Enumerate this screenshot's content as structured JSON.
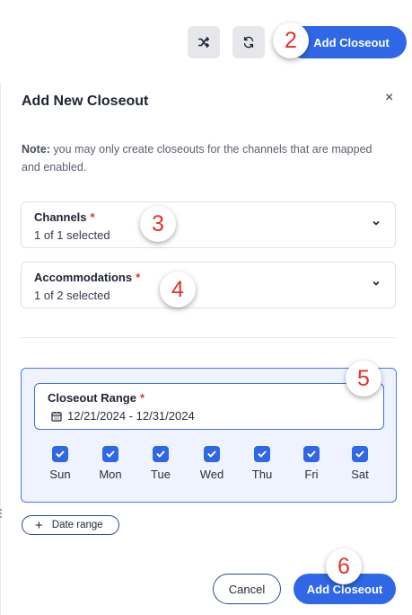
{
  "toolbar": {
    "shuffle_icon": "shuffle-icon",
    "refresh_icon": "refresh-icon",
    "add_closeout_label": "Add Closeout"
  },
  "badges": {
    "b2": "2",
    "b3": "3",
    "b4": "4",
    "b5": "5",
    "b6": "6"
  },
  "panel": {
    "title": "Add New Closeout",
    "close_label": "×",
    "note_prefix": "Note:",
    "note_text": " you may only create closeouts for the channels that are mapped and enabled."
  },
  "channels": {
    "label": "Channels",
    "required_mark": "*",
    "value": "1 of 1 selected"
  },
  "accommodations": {
    "label": "Accommodations",
    "required_mark": "*",
    "value": "1 of 2 selected"
  },
  "closeout_range": {
    "label": "Closeout Range",
    "required_mark": "*",
    "value": "12/21/2024 - 12/31/2024"
  },
  "days": [
    {
      "name": "Sun",
      "checked": true
    },
    {
      "name": "Mon",
      "checked": true
    },
    {
      "name": "Tue",
      "checked": true
    },
    {
      "name": "Wed",
      "checked": true
    },
    {
      "name": "Thu",
      "checked": true
    },
    {
      "name": "Fri",
      "checked": true
    },
    {
      "name": "Sat",
      "checked": true
    }
  ],
  "date_range_button": {
    "plus": "+",
    "label": "Date range"
  },
  "footer": {
    "cancel_label": "Cancel",
    "add_label": "Add Closeout"
  },
  "colors": {
    "accent": "#2f67e6",
    "badge_text": "#e0342b",
    "required": "#e0342b"
  }
}
